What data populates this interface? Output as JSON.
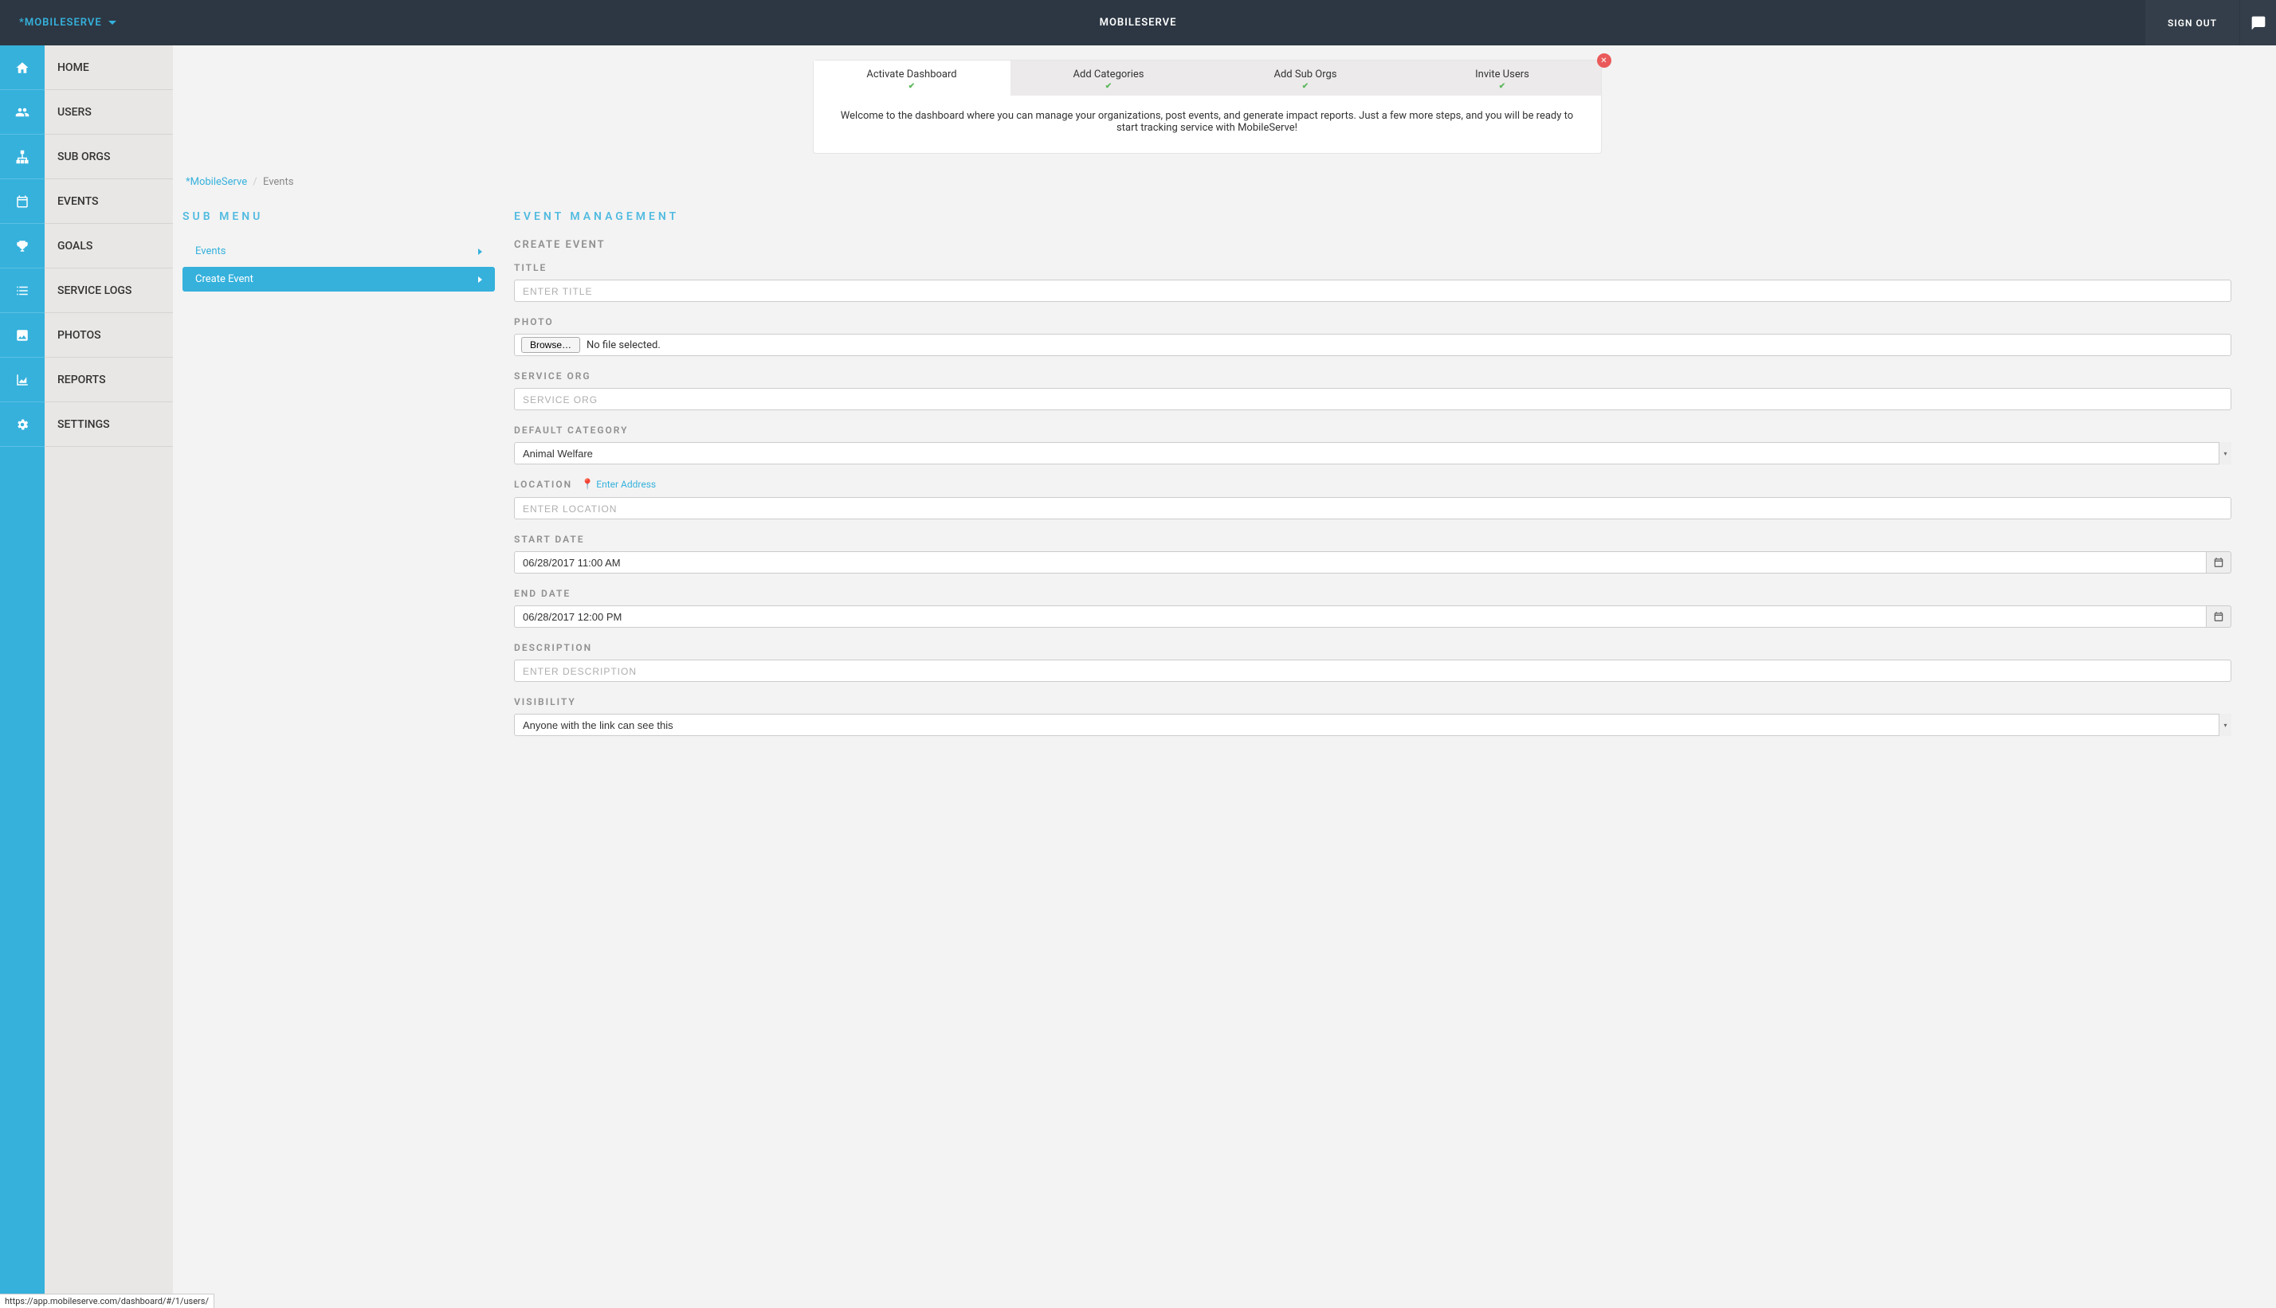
{
  "header": {
    "brand": "*MOBILESERVE",
    "center": "MOBILESERVE",
    "signout": "SIGN OUT"
  },
  "nav": [
    "HOME",
    "USERS",
    "SUB ORGS",
    "EVENTS",
    "GOALS",
    "SERVICE LOGS",
    "PHOTOS",
    "REPORTS",
    "SETTINGS"
  ],
  "setup": {
    "tabs": [
      "Activate Dashboard",
      "Add Categories",
      "Add Sub Orgs",
      "Invite Users"
    ],
    "body": "Welcome to the dashboard where you can manage your organizations, post events, and generate impact reports. Just a few more steps, and you will be ready to start tracking service with MobileServe!"
  },
  "breadcrumb": {
    "root": "*MobileServe",
    "current": "Events"
  },
  "submenu": {
    "heading": "SUB MENU",
    "items": [
      {
        "label": "Events",
        "active": false
      },
      {
        "label": "Create Event",
        "active": true
      }
    ]
  },
  "form": {
    "heading": "EVENT MANAGEMENT",
    "subtitle": "CREATE EVENT",
    "title_label": "TITLE",
    "title_placeholder": "ENTER TITLE",
    "photo_label": "PHOTO",
    "browse_label": "Browse…",
    "no_file": "No file selected.",
    "service_org_label": "SERVICE ORG",
    "service_org_placeholder": "SERVICE ORG",
    "default_category_label": "DEFAULT CATEGORY",
    "default_category_value": "Animal Welfare",
    "location_label": "LOCATION",
    "location_link": "Enter Address",
    "location_placeholder": "ENTER LOCATION",
    "start_date_label": "START DATE",
    "start_date_value": "06/28/2017 11:00 AM",
    "end_date_label": "END DATE",
    "end_date_value": "06/28/2017 12:00 PM",
    "description_label": "DESCRIPTION",
    "description_placeholder": "ENTER DESCRIPTION",
    "visibility_label": "VISIBILITY",
    "visibility_value": "Anyone with the link can see this"
  },
  "statusbar": "https://app.mobileserve.com/dashboard/#/1/users/"
}
